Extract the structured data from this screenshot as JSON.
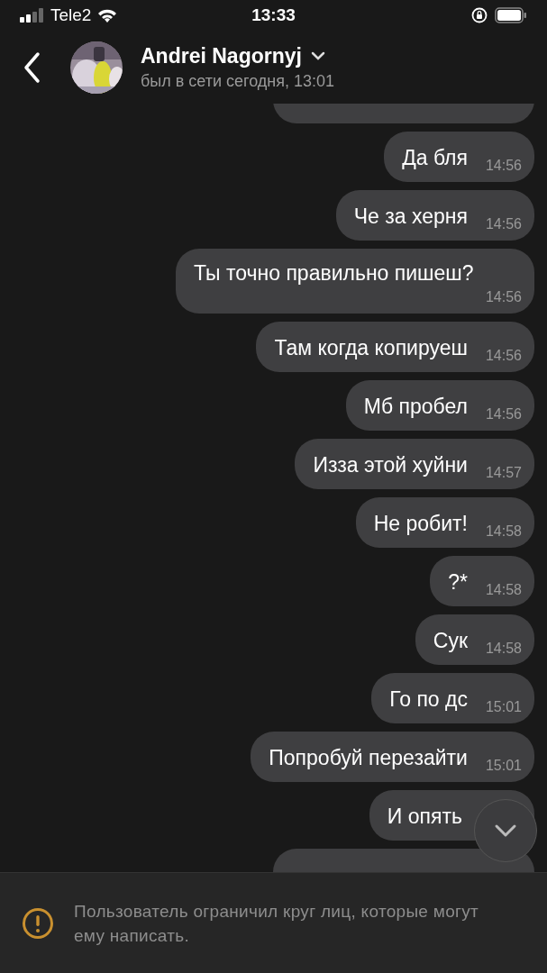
{
  "status_bar": {
    "carrier": "Tele2",
    "time": "13:33"
  },
  "header": {
    "name": "Andrei Nagornyj",
    "status": "был в сети сегодня, 13:01"
  },
  "messages": [
    {
      "kind": "partial"
    },
    {
      "kind": "bubble",
      "text": "Да бля",
      "time": "14:56"
    },
    {
      "kind": "bubble",
      "text": "Че за херня",
      "time": "14:56"
    },
    {
      "kind": "bubble",
      "text": "Ты точно правильно пишеш?",
      "time": "14:56"
    },
    {
      "kind": "bubble",
      "text": "Там когда копируеш",
      "time": "14:56"
    },
    {
      "kind": "bubble",
      "text": "Мб пробел",
      "time": "14:56"
    },
    {
      "kind": "bubble",
      "text": "Изза этой хуйни",
      "time": "14:57"
    },
    {
      "kind": "bubble",
      "text": "Не робит!",
      "time": "14:58"
    },
    {
      "kind": "bubble",
      "text": "?*",
      "time": "14:58"
    },
    {
      "kind": "bubble",
      "text": "Сук",
      "time": "14:58"
    },
    {
      "kind": "bubble",
      "text": "Го по дс",
      "time": "15:01"
    },
    {
      "kind": "bubble",
      "text": "Попробуй перезайти",
      "time": "15:01"
    },
    {
      "kind": "bubble",
      "text": "И опять"
    },
    {
      "kind": "partial"
    }
  ],
  "notice": "Пользователь ограничил круг лиц, которые могут ему написать."
}
